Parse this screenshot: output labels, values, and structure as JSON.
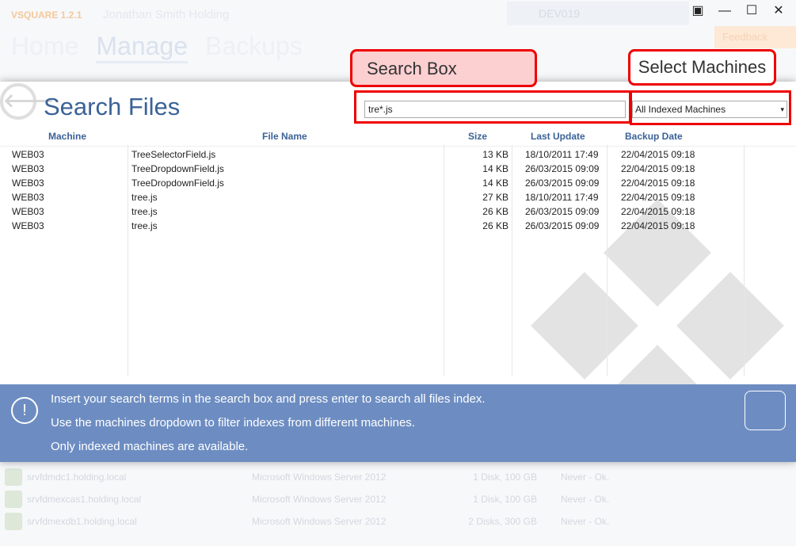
{
  "background": {
    "app_title": "VSQUARE 1.2.1",
    "user_label": "Jonathan Smith Holding",
    "device_name": "DEV019",
    "feedback_label": "Feedback",
    "tabs": [
      "Home",
      "Manage",
      "Backups"
    ],
    "rows": [
      {
        "name": "srvfdmdc1.holding.local",
        "os": "Microsoft Windows Server 2012",
        "disks": "1 Disk, 100 GB",
        "status": "Never - Ok."
      },
      {
        "name": "srvfdmexcas1.holding.local",
        "os": "Microsoft Windows Server 2012",
        "disks": "1 Disk, 100 GB",
        "status": "Never - Ok."
      },
      {
        "name": "srvfdmexdb1.holding.local",
        "os": "Microsoft Windows Server 2012",
        "disks": "2 Disks, 300 GB",
        "status": "Never - Ok."
      }
    ]
  },
  "window_controls": {
    "account": "▣",
    "minimize": "—",
    "maximize": "☐",
    "close": "✕"
  },
  "dialog": {
    "title": "Search Files",
    "back_icon": "🡐",
    "search": {
      "value": "tre*.js",
      "placeholder": ""
    },
    "machine_select": {
      "selected": "All Indexed Machines",
      "caret": "▾"
    },
    "columns": {
      "machine": "Machine",
      "file_name": "File Name",
      "size": "Size",
      "last_update": "Last Update",
      "backup_date": "Backup Date"
    },
    "rows": [
      {
        "machine": "WEB03",
        "file": "TreeSelectorField.js",
        "size": "13 KB",
        "last_update": "18/10/2011 17:49",
        "backup_date": "22/04/2015 09:18"
      },
      {
        "machine": "WEB03",
        "file": "TreeDropdownField.js",
        "size": "14 KB",
        "last_update": "26/03/2015 09:09",
        "backup_date": "22/04/2015 09:18"
      },
      {
        "machine": "WEB03",
        "file": "TreeDropdownField.js",
        "size": "14 KB",
        "last_update": "26/03/2015 09:09",
        "backup_date": "22/04/2015 09:18"
      },
      {
        "machine": "WEB03",
        "file": "tree.js",
        "size": "27 KB",
        "last_update": "18/10/2011 17:49",
        "backup_date": "22/04/2015 09:18"
      },
      {
        "machine": "WEB03",
        "file": "tree.js",
        "size": "26 KB",
        "last_update": "26/03/2015 09:09",
        "backup_date": "22/04/2015 09:18"
      },
      {
        "machine": "WEB03",
        "file": "tree.js",
        "size": "26 KB",
        "last_update": "26/03/2015 09:09",
        "backup_date": "22/04/2015 09:18"
      }
    ],
    "info": {
      "icon": "!",
      "lines": [
        "Insert your search terms in the search box and press enter to search all files index.",
        "Use the machines dropdown to filter indexes from different machines.",
        "Only indexed machines are available."
      ]
    }
  },
  "annotations": {
    "search_box": "Search Box",
    "select_machines": "Select Machines"
  },
  "colors": {
    "accent": "#3b6297",
    "info_bar": "#6d8dc2",
    "callout_border": "#ee0000",
    "callout_fill": "#fccfd1"
  }
}
